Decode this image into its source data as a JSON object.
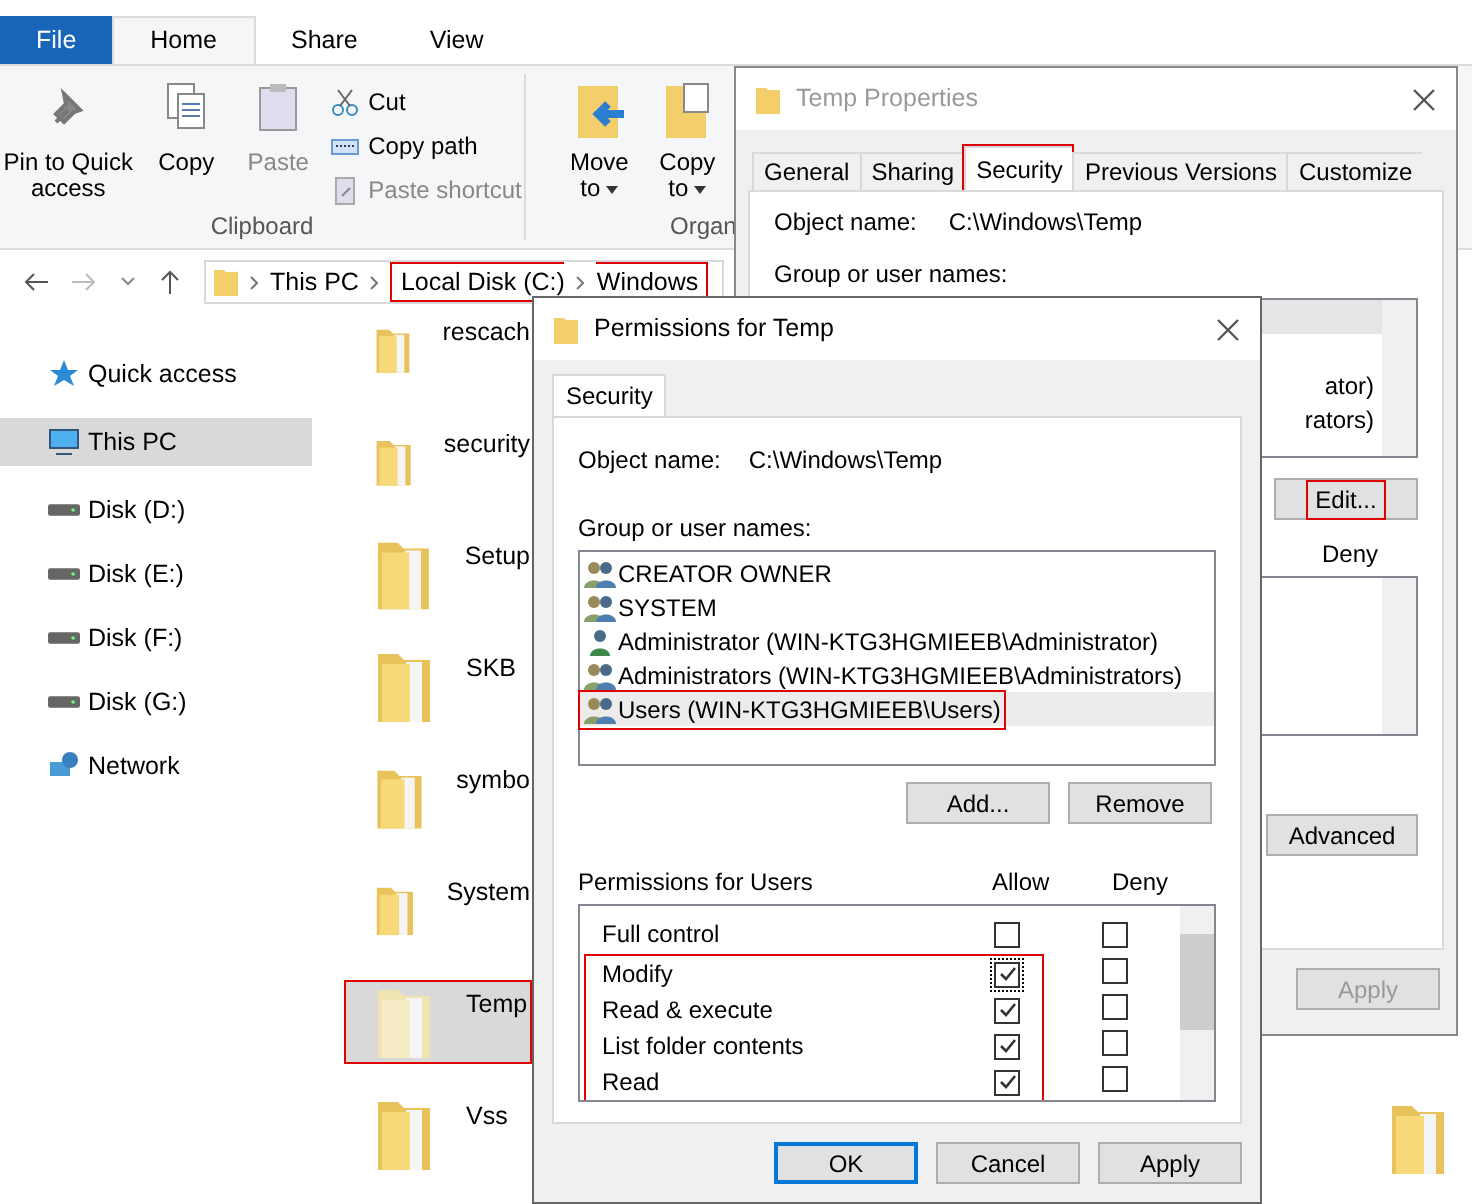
{
  "explorer": {
    "ribbon_tabs": [
      {
        "label": "File",
        "kind": "file",
        "selected": false
      },
      {
        "label": "Home",
        "kind": "tab",
        "selected": true
      },
      {
        "label": "Share",
        "kind": "tab",
        "selected": false
      },
      {
        "label": "View",
        "kind": "tab",
        "selected": false
      }
    ],
    "clipboard": {
      "large": [
        {
          "label": "Pin to Quick access",
          "kind": "pin",
          "disabled": false
        },
        {
          "label": "Copy",
          "kind": "copy",
          "disabled": false
        },
        {
          "label": "Paste",
          "kind": "paste",
          "disabled": true
        }
      ],
      "small": [
        {
          "label": "Cut",
          "kind": "cut",
          "disabled": false
        },
        {
          "label": "Copy path",
          "kind": "path",
          "disabled": false
        },
        {
          "label": "Paste shortcut",
          "kind": "shortcut",
          "disabled": true
        }
      ],
      "group_label": "Clipboard"
    },
    "organize": {
      "buttons": [
        {
          "label": "Move to",
          "kind": "move"
        },
        {
          "label": "Copy to",
          "kind": "copyto"
        }
      ],
      "group_label": "Organ"
    },
    "address": [
      {
        "label": "This PC",
        "highlighted": false
      },
      {
        "label": "Local Disk (C:)",
        "highlighted": true
      },
      {
        "label": "Windows",
        "highlighted": true
      }
    ],
    "sidebar": [
      {
        "label": "Quick access",
        "kind": "star",
        "selected": false
      },
      {
        "label": "This PC",
        "kind": "pc",
        "selected": true
      },
      {
        "label": "Disk (D:)",
        "kind": "drive",
        "selected": false
      },
      {
        "label": "Disk (E:)",
        "kind": "drive",
        "selected": false
      },
      {
        "label": "Disk (F:)",
        "kind": "drive",
        "selected": false
      },
      {
        "label": "Disk (G:)",
        "kind": "drive",
        "selected": false
      },
      {
        "label": "Network",
        "kind": "network",
        "selected": false
      }
    ],
    "files": [
      {
        "name": "rescach",
        "selected": false,
        "highlighted": false
      },
      {
        "name": "security",
        "selected": false,
        "highlighted": false
      },
      {
        "name": "Setup",
        "selected": false,
        "highlighted": false
      },
      {
        "name": "SKB",
        "selected": false,
        "highlighted": false
      },
      {
        "name": "symbo",
        "selected": false,
        "highlighted": false
      },
      {
        "name": "System",
        "selected": false,
        "highlighted": false
      },
      {
        "name": "Temp",
        "selected": true,
        "highlighted": true
      },
      {
        "name": "Vss",
        "selected": false,
        "highlighted": false
      }
    ]
  },
  "properties": {
    "title": "Temp Properties",
    "tabs": [
      {
        "label": "General",
        "selected": false,
        "highlighted": false
      },
      {
        "label": "Sharing",
        "selected": false,
        "highlighted": false
      },
      {
        "label": "Security",
        "selected": true,
        "highlighted": true
      },
      {
        "label": "Previous Versions",
        "selected": false,
        "highlighted": false
      },
      {
        "label": "Customize",
        "selected": false,
        "highlighted": false
      }
    ],
    "object_label": "Object name:",
    "object_value": "C:\\Windows\\Temp",
    "group_label": "Group or user names:",
    "users": [
      {
        "selected": true
      },
      {
        "selected": false
      },
      {
        "name": "ator)",
        "selected": false
      },
      {
        "name": "rators)",
        "selected": false
      }
    ],
    "edit_button": {
      "label": "Edit...",
      "highlighted": true
    },
    "deny_header": "Deny",
    "advanced_button": "Advanced",
    "buttons": [
      {
        "label": "Apply",
        "disabled": true
      }
    ]
  },
  "permissions": {
    "title": "Permissions for Temp",
    "tab": "Security",
    "object_label": "Object name:",
    "object_value": "C:\\Windows\\Temp",
    "group_label": "Group or user names:",
    "users": [
      {
        "name": "CREATOR OWNER",
        "kind": "group",
        "selected": false,
        "highlighted": false
      },
      {
        "name": "SYSTEM",
        "kind": "group",
        "selected": false,
        "highlighted": false
      },
      {
        "name": "Administrator (WIN-KTG3HGMIEEB\\Administrator)",
        "kind": "user",
        "selected": false,
        "highlighted": false
      },
      {
        "name": "Administrators (WIN-KTG3HGMIEEB\\Administrators)",
        "kind": "group",
        "selected": false,
        "highlighted": false
      },
      {
        "name": "Users (WIN-KTG3HGMIEEB\\Users)",
        "kind": "group",
        "selected": true,
        "highlighted": true
      }
    ],
    "add_button": "Add...",
    "remove_button": "Remove",
    "perm_label": "Permissions for Users",
    "allow_header": "Allow",
    "deny_header": "Deny",
    "perms": [
      {
        "name": "Full control",
        "allow": false,
        "deny": false,
        "focused": false,
        "highlighted": false
      },
      {
        "name": "Modify",
        "allow": true,
        "deny": false,
        "focused": true,
        "highlighted": true
      },
      {
        "name": "Read & execute",
        "allow": true,
        "deny": false,
        "focused": false,
        "highlighted": true
      },
      {
        "name": "List folder contents",
        "allow": true,
        "deny": false,
        "focused": false,
        "highlighted": true
      },
      {
        "name": "Read",
        "allow": true,
        "deny": false,
        "focused": false,
        "highlighted": true
      }
    ],
    "buttons": [
      {
        "label": "OK",
        "default": true
      },
      {
        "label": "Cancel",
        "default": false
      },
      {
        "label": "Apply",
        "default": false
      }
    ]
  }
}
